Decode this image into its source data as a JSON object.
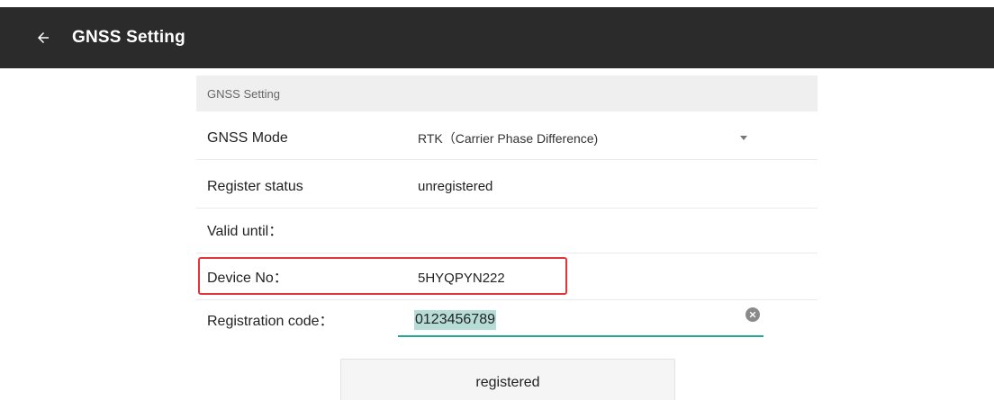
{
  "appbar": {
    "title": "GNSS Setting",
    "back_icon": "arrow-left-icon"
  },
  "section": {
    "header": "GNSS Setting"
  },
  "fields": {
    "gnss_mode": {
      "label": "GNSS Mode",
      "value": "RTK（Carrier Phase Difference)",
      "icon": "dropdown-arrow-icon"
    },
    "register_status": {
      "label": "Register status",
      "value": "unregistered"
    },
    "valid_until": {
      "label": "Valid until：",
      "value": ""
    },
    "device_no": {
      "label": "Device No：",
      "value": "5HYQPYN222"
    },
    "registration_code": {
      "label": "Registration code：",
      "value": "0123456789",
      "clear_icon": "clear-circle-icon"
    }
  },
  "actions": {
    "register_label": "registered"
  },
  "colors": {
    "appbar_bg": "#2b2b2b",
    "highlight_border": "#e0363a",
    "input_underline": "#26a69a",
    "text_selection": "#b7dcd6"
  }
}
